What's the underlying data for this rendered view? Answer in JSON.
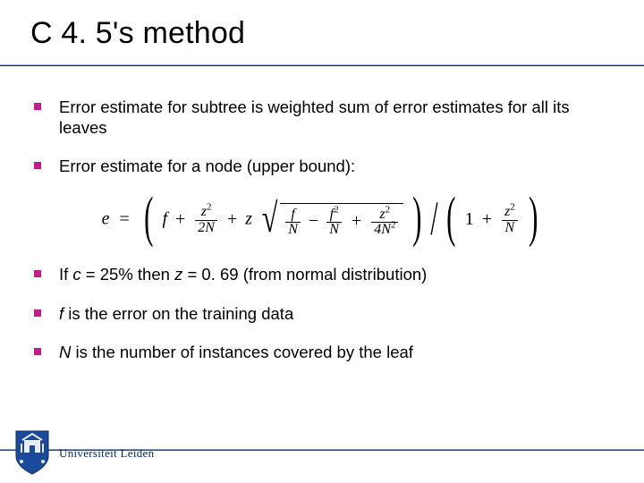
{
  "title": "C 4. 5's method",
  "bullets": {
    "b1": "Error estimate for subtree is weighted sum of error estimates for all its leaves",
    "b2": "Error estimate for a node (upper bound):",
    "b3_pre": "If ",
    "b3_c": "c",
    "b3_mid1": " = 25% then ",
    "b3_z": "z",
    "b3_mid2": " = 0. 69 (from normal distribution)",
    "b4_f": "f ",
    "b4_rest": " is the error on the training data",
    "b5_N": "N",
    "b5_rest": " is the number of instances covered by the leaf"
  },
  "formula": {
    "e": "e",
    "eq1": "=",
    "f": "f",
    "plus": "+",
    "minus": "−",
    "z2": "z",
    "sq": "2",
    "two_n": "2N",
    "z": "z",
    "fN_num": "f",
    "N": "N",
    "f2": "f",
    "four_n2_a": "4N",
    "one": "1",
    "slash": "/"
  },
  "footer": {
    "university": "Universiteit Leiden"
  }
}
